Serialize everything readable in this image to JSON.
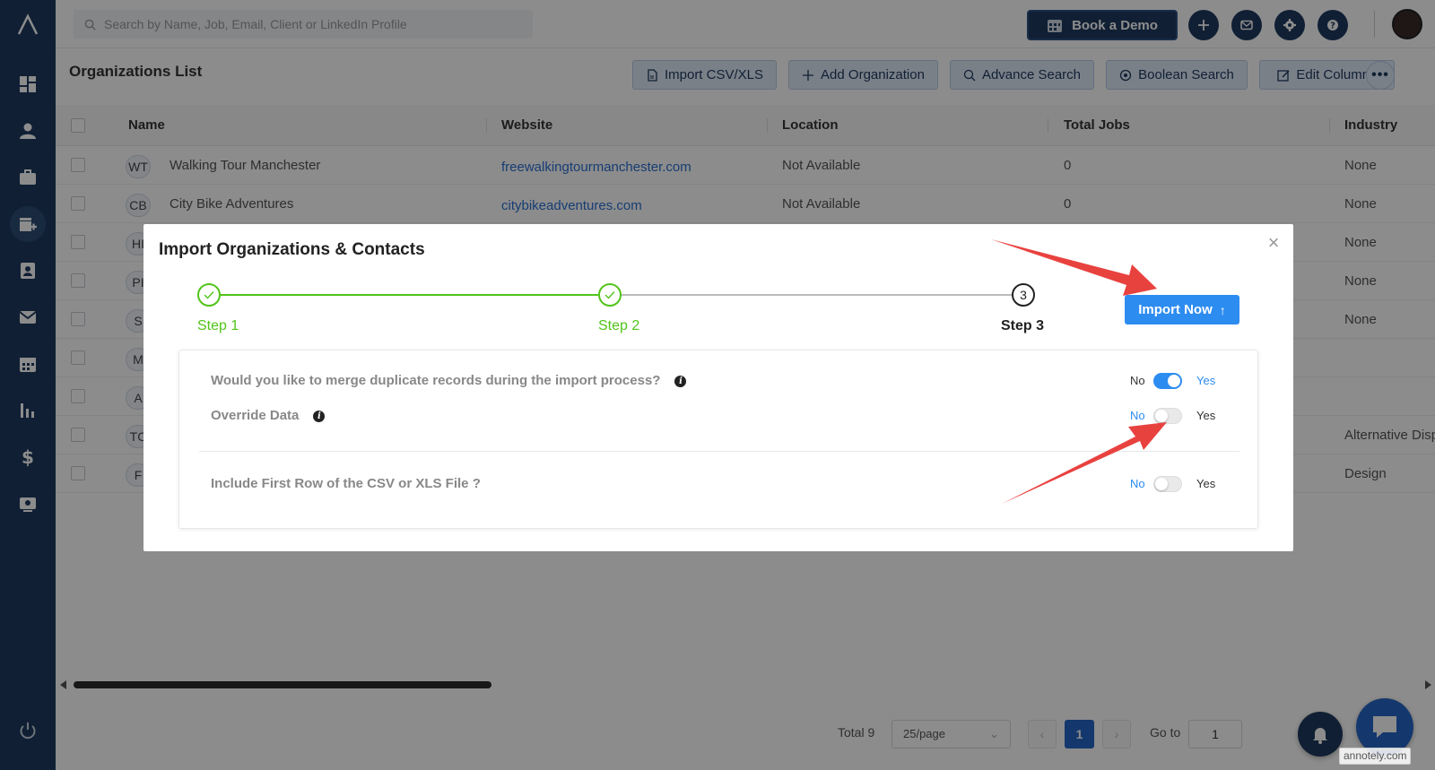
{
  "topbar": {
    "search_placeholder": "Search by Name, Job, Email, Client or LinkedIn Profile",
    "book_demo_label": "Book a Demo"
  },
  "page": {
    "title": "Organizations List"
  },
  "toolbar": {
    "import_label": "Import CSV/XLS",
    "add_label": "Add Organization",
    "advance_label": "Advance Search",
    "boolean_label": "Boolean Search",
    "edit_columns_label": "Edit Columns",
    "more_label": "•••"
  },
  "table": {
    "headers": [
      "Name",
      "Website",
      "Location",
      "Total Jobs",
      "Industry"
    ],
    "rows": [
      {
        "initials": "WT",
        "name": "Walking Tour Manchester",
        "website": "freewalkingtourmanchester.com",
        "location": "Not Available",
        "jobs": "0",
        "industry": "None"
      },
      {
        "initials": "CB",
        "name": "City Bike Adventures",
        "website": "citybikeadventures.com",
        "location": "Not Available",
        "jobs": "0",
        "industry": "None"
      },
      {
        "initials": "HI",
        "name": "",
        "website": "",
        "location": "",
        "jobs": "",
        "industry": "None"
      },
      {
        "initials": "PI",
        "name": "",
        "website": "",
        "location": "",
        "jobs": "",
        "industry": "None"
      },
      {
        "initials": "S",
        "name": "",
        "website": "",
        "location": "",
        "jobs": "",
        "industry": "None"
      },
      {
        "initials": "M",
        "name": "",
        "website": "",
        "location": "",
        "jobs": "",
        "industry": ""
      },
      {
        "initials": "A",
        "name": "",
        "website": "",
        "location": "",
        "jobs": "",
        "industry": ""
      },
      {
        "initials": "TC",
        "name": "",
        "website": "",
        "location": "",
        "jobs": "",
        "industry": "Alternative Disp"
      },
      {
        "initials": "F",
        "name": "",
        "website": "",
        "location": "",
        "jobs": "",
        "industry": "Design"
      }
    ]
  },
  "pagination": {
    "total": "Total 9",
    "page_size": "25/page",
    "current_page": "1",
    "goto_label": "Go to",
    "goto_value": "1"
  },
  "modal": {
    "title": "Import Organizations & Contacts",
    "close": "×",
    "steps": [
      {
        "label": "Step 1",
        "status": "done"
      },
      {
        "label": "Step 2",
        "status": "done"
      },
      {
        "label": "Step 3",
        "status": "current",
        "number": "3"
      }
    ],
    "import_now_label": "Import Now",
    "import_now_icon": "↑",
    "options": [
      {
        "label": "Would you like to merge duplicate records during the import process?",
        "info": "i",
        "no": "No",
        "yes": "Yes",
        "enabled": true
      },
      {
        "label": "Override Data",
        "info": "i",
        "no": "No",
        "yes": "Yes",
        "enabled": false
      },
      {
        "label": "Include First Row of the CSV or XLS File ?",
        "no": "No",
        "yes": "Yes",
        "enabled": false
      }
    ]
  },
  "watermark": "annotely.com",
  "colors": {
    "sidebar": "#1e3a5f",
    "primary": "#2d8cf0",
    "success": "#52c41a",
    "annotation": "#e8423f"
  }
}
